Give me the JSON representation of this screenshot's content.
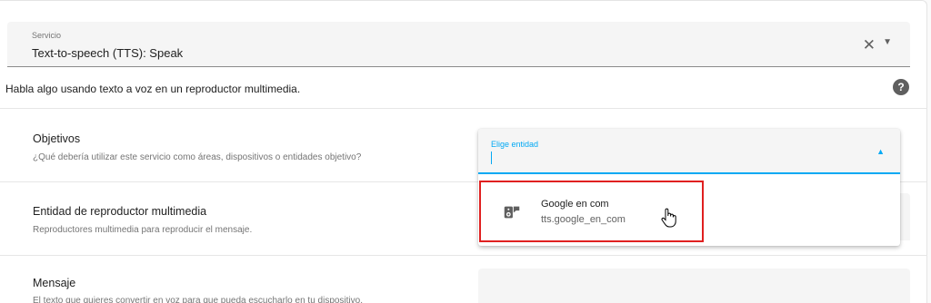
{
  "service": {
    "label": "Servicio",
    "value": "Text-to-speech (TTS): Speak",
    "clear_icon": "close-icon",
    "dropdown_icon": "arrow-drop-down-icon"
  },
  "description": "Habla algo usando texto a voz en un reproductor multimedia.",
  "help_icon": "help-circle-icon",
  "rows": [
    {
      "title": "Objetivos",
      "subtitle": "¿Qué debería utilizar este servicio como áreas, dispositivos o entidades objetivo?"
    },
    {
      "title": "Entidad de reproductor multimedia",
      "subtitle": "Reproductores multimedia para reproducir el mensaje."
    },
    {
      "title": "Mensaje",
      "subtitle": "El texto que quieres convertir en voz para que pueda escucharlo en tu dispositivo."
    }
  ],
  "entity_picker": {
    "label": "Elige entidad",
    "value": "",
    "arrow_icon": "arrow-drop-up-icon",
    "options": [
      {
        "name": "Google en com",
        "entity_id": "tts.google_en_com",
        "icon": "speaker-message-icon"
      }
    ]
  },
  "colors": {
    "accent": "#03a9f4",
    "highlight": "#e02020"
  }
}
